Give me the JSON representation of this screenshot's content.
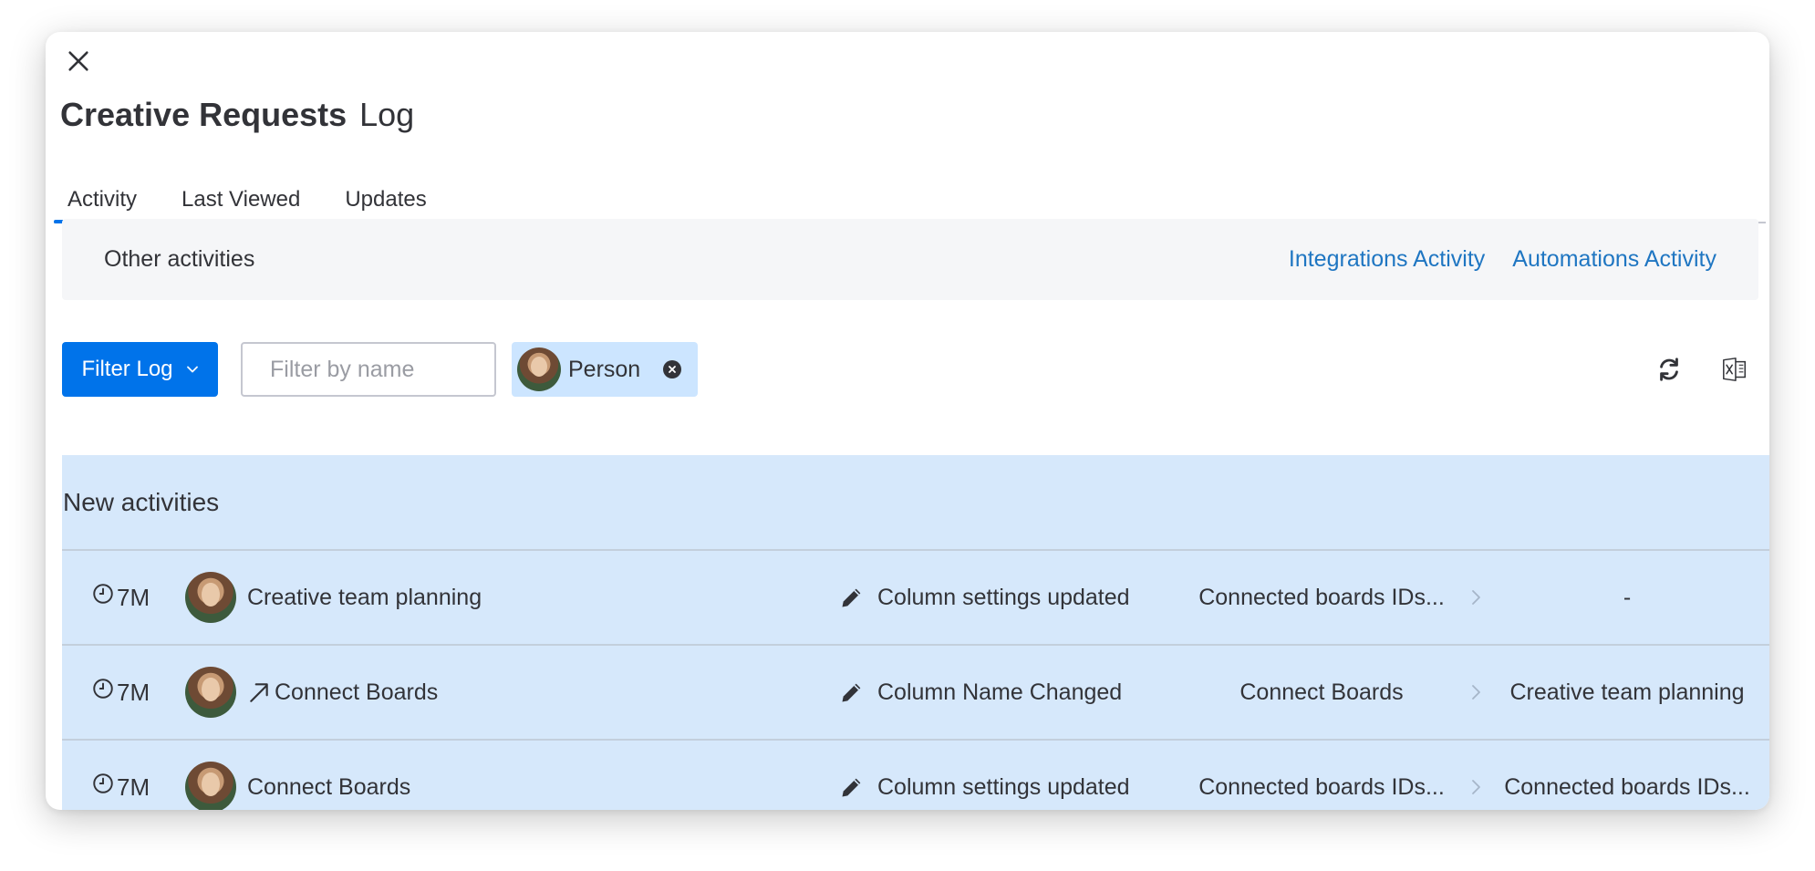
{
  "header": {
    "title_bold": "Creative Requests",
    "title_light": "Log"
  },
  "tabs": [
    {
      "label": "Activity",
      "active": true
    },
    {
      "label": "Last Viewed",
      "active": false
    },
    {
      "label": "Updates",
      "active": false
    }
  ],
  "other_activities": {
    "label": "Other activities",
    "links": [
      "Integrations Activity",
      "Automations Activity"
    ]
  },
  "toolbar": {
    "filter_label": "Filter Log",
    "filter_placeholder": "Filter by name",
    "person_chip": "Person"
  },
  "activities": {
    "section_title": "New activities",
    "rows": [
      {
        "time": "7M",
        "name": "Creative team planning",
        "has_link_arrow": false,
        "action": "Column settings updated",
        "from": "Connected boards IDs...",
        "to": "-"
      },
      {
        "time": "7M",
        "name": "Connect Boards",
        "has_link_arrow": true,
        "action": "Column Name Changed",
        "from": "Connect Boards",
        "to": "Creative team planning"
      },
      {
        "time": "7M",
        "name": "Connect Boards",
        "has_link_arrow": false,
        "action": "Column settings updated",
        "from": "Connected boards IDs...",
        "to": "Connected boards IDs..."
      }
    ]
  },
  "colors": {
    "accent": "#0073ea",
    "link": "#1f76c2",
    "highlight": "#d6e8fb",
    "chip": "#cce5ff"
  }
}
